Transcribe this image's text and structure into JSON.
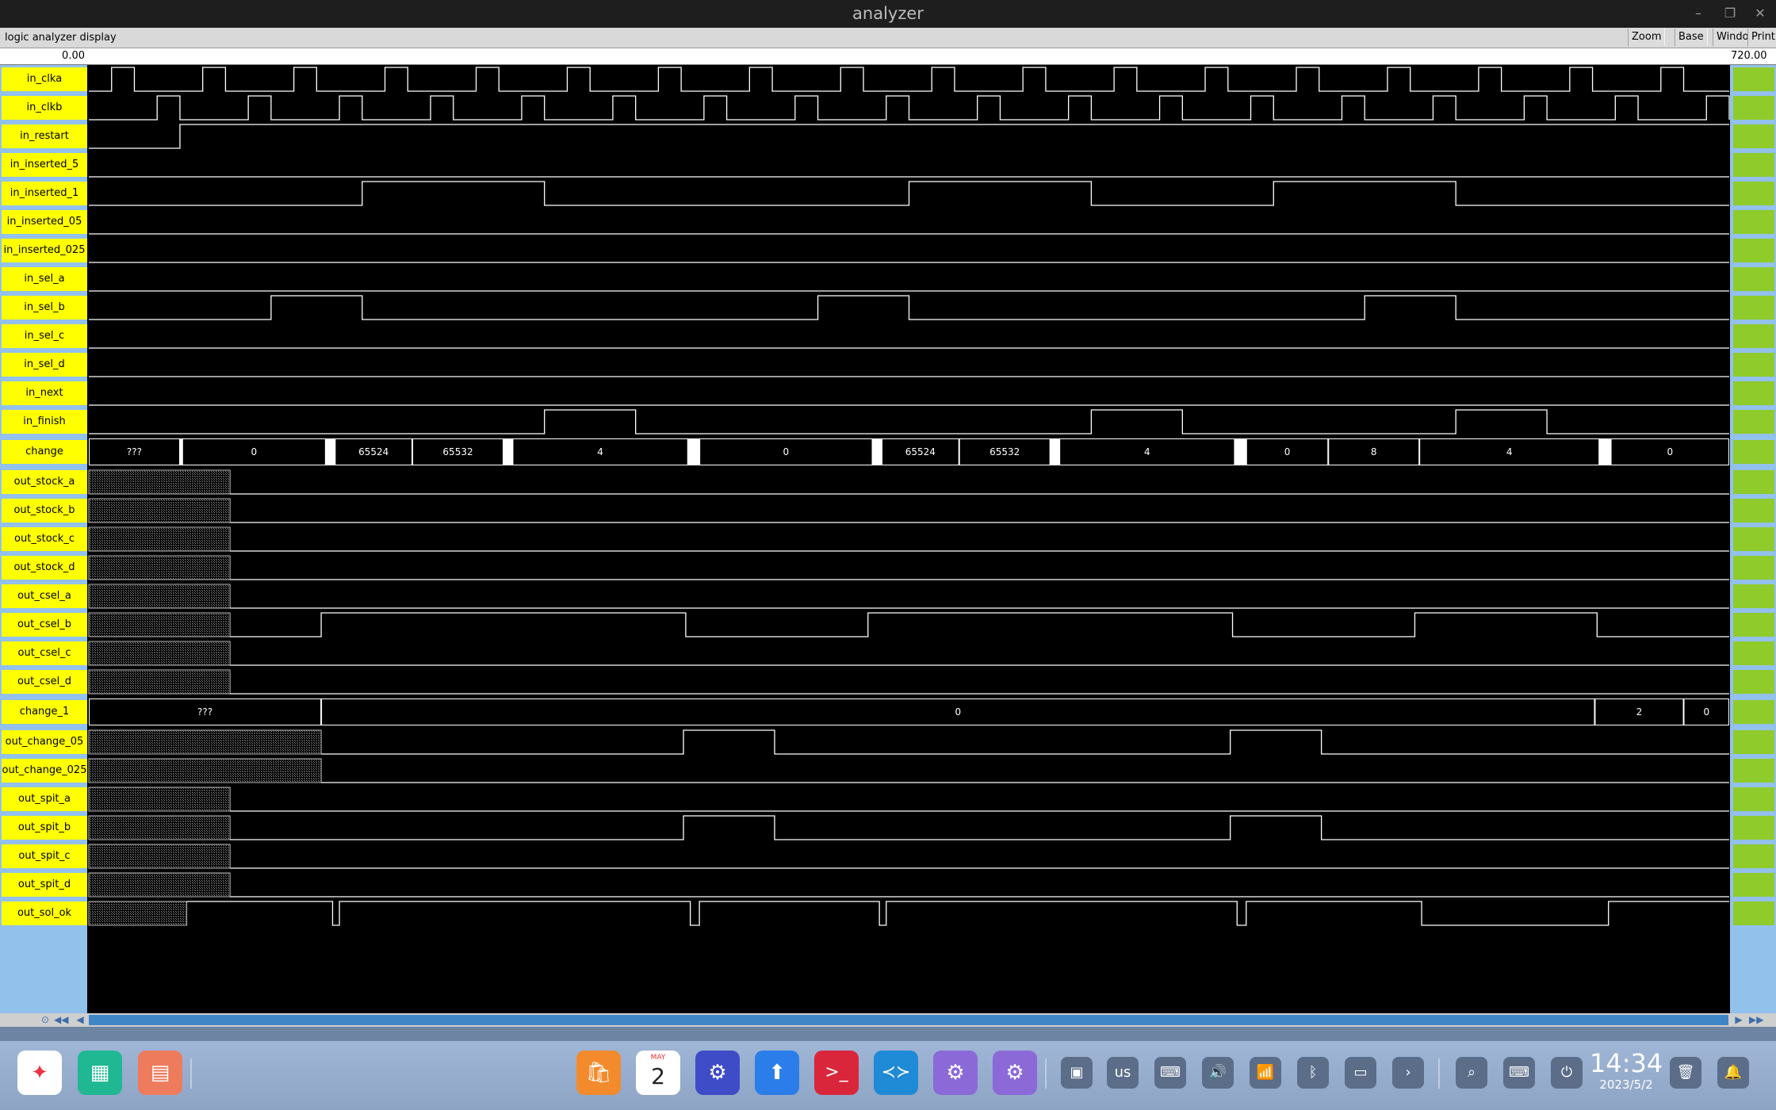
{
  "window": {
    "title": "analyzer",
    "minimize_glyph": "–",
    "restore_glyph": "❐",
    "close_glyph": "✕"
  },
  "toolbar": {
    "label": "logic analyzer display",
    "zoom": "Zoom",
    "base": "Base",
    "window": "Window",
    "print": "Print"
  },
  "ruler": {
    "start": "0.00",
    "end": "720.00"
  },
  "colors": {
    "signal_label_bg": "#ffff00",
    "side_bg": "#92c1ec",
    "green_cell": "#8fcb2a",
    "wave": "#ffffff",
    "hatch": "#808080"
  },
  "timeline": {
    "start": 0,
    "end": 720
  },
  "signals": [
    {
      "name": "in_clka",
      "kind": "clock",
      "period": 40,
      "high_start": 10,
      "high_len": 10
    },
    {
      "name": "in_clkb",
      "kind": "clock",
      "period": 40,
      "high_start": 30,
      "high_len": 10
    },
    {
      "name": "in_restart",
      "kind": "bit",
      "initial": 0,
      "edges": [
        40
      ]
    },
    {
      "name": "in_inserted_5",
      "kind": "bit",
      "initial": 0,
      "edges": []
    },
    {
      "name": "in_inserted_1",
      "kind": "bit",
      "initial": 0,
      "edges": [
        120,
        200,
        360,
        440,
        520,
        600
      ]
    },
    {
      "name": "in_inserted_05",
      "kind": "bit",
      "initial": 0,
      "edges": []
    },
    {
      "name": "in_inserted_025",
      "kind": "bit",
      "initial": 0,
      "edges": []
    },
    {
      "name": "in_sel_a",
      "kind": "bit",
      "initial": 0,
      "edges": []
    },
    {
      "name": "in_sel_b",
      "kind": "bit",
      "initial": 0,
      "edges": [
        80,
        120,
        320,
        360,
        560,
        600
      ]
    },
    {
      "name": "in_sel_c",
      "kind": "bit",
      "initial": 0,
      "edges": []
    },
    {
      "name": "in_sel_d",
      "kind": "bit",
      "initial": 0,
      "edges": []
    },
    {
      "name": "in_next",
      "kind": "bit",
      "initial": 0,
      "edges": []
    },
    {
      "name": "in_finish",
      "kind": "bit",
      "initial": 0,
      "edges": [
        200,
        240,
        440,
        480,
        600,
        640
      ]
    },
    {
      "name": "change",
      "kind": "bus",
      "segments": [
        {
          "s": 0,
          "e": 40,
          "v": "???"
        },
        {
          "s": 41,
          "e": 104,
          "v": "0"
        },
        {
          "s": 108,
          "e": 142,
          "v": "65524"
        },
        {
          "s": 142,
          "e": 182,
          "v": "65532"
        },
        {
          "s": 186,
          "e": 263,
          "v": "4"
        },
        {
          "s": 268,
          "e": 344,
          "v": "0"
        },
        {
          "s": 348,
          "e": 382,
          "v": "65524"
        },
        {
          "s": 382,
          "e": 422,
          "v": "65532"
        },
        {
          "s": 426,
          "e": 503,
          "v": "4"
        },
        {
          "s": 508,
          "e": 544,
          "v": "0"
        },
        {
          "s": 544,
          "e": 584,
          "v": "8"
        },
        {
          "s": 584,
          "e": 663,
          "v": "4"
        },
        {
          "s": 668,
          "e": 720,
          "v": "0"
        }
      ]
    },
    {
      "name": "out_stock_a",
      "kind": "bit",
      "unknown_until": 62,
      "initial": 0,
      "edges": []
    },
    {
      "name": "out_stock_b",
      "kind": "bit",
      "unknown_until": 62,
      "initial": 0,
      "edges": []
    },
    {
      "name": "out_stock_c",
      "kind": "bit",
      "unknown_until": 62,
      "initial": 0,
      "edges": []
    },
    {
      "name": "out_stock_d",
      "kind": "bit",
      "unknown_until": 62,
      "initial": 0,
      "edges": []
    },
    {
      "name": "out_csel_a",
      "kind": "bit",
      "unknown_until": 62,
      "initial": 0,
      "edges": []
    },
    {
      "name": "out_csel_b",
      "kind": "bit",
      "unknown_until": 62,
      "initial": 0,
      "edges": [
        102,
        262,
        342,
        502,
        582,
        662
      ]
    },
    {
      "name": "out_csel_c",
      "kind": "bit",
      "unknown_until": 62,
      "initial": 0,
      "edges": []
    },
    {
      "name": "out_csel_d",
      "kind": "bit",
      "unknown_until": 62,
      "initial": 0,
      "edges": []
    },
    {
      "name": "change_1",
      "kind": "bus",
      "segments": [
        {
          "s": 0,
          "e": 102,
          "v": "???"
        },
        {
          "s": 102,
          "e": 661,
          "v": "0"
        },
        {
          "s": 661,
          "e": 700,
          "v": "2"
        },
        {
          "s": 700,
          "e": 720,
          "v": "0"
        }
      ]
    },
    {
      "name": "out_change_05",
      "kind": "bit",
      "unknown_until": 102,
      "initial": 0,
      "edges": [
        261,
        301,
        501,
        541
      ]
    },
    {
      "name": "out_change_025",
      "kind": "bit",
      "unknown_until": 102,
      "initial": 0,
      "edges": []
    },
    {
      "name": "out_spit_a",
      "kind": "bit",
      "unknown_until": 62,
      "initial": 0,
      "edges": []
    },
    {
      "name": "out_spit_b",
      "kind": "bit",
      "unknown_until": 62,
      "initial": 0,
      "edges": [
        261,
        301,
        501,
        541
      ]
    },
    {
      "name": "out_spit_c",
      "kind": "bit",
      "unknown_until": 62,
      "initial": 0,
      "edges": []
    },
    {
      "name": "out_spit_d",
      "kind": "bit",
      "unknown_until": 62,
      "initial": 0,
      "edges": []
    },
    {
      "name": "out_sol_ok",
      "kind": "bit",
      "unknown_until": 43,
      "initial": 1,
      "edges": [
        107,
        110,
        264,
        268,
        347,
        350,
        504,
        508,
        585,
        667
      ]
    }
  ],
  "scrollbar": {
    "home_glyph": "⊙",
    "rewind_glyph": "◀◀",
    "back_glyph": "◀",
    "fwd_glyph": "▶",
    "ffwd_glyph": "▶▶"
  },
  "dock": {
    "apps": [
      {
        "name": "launcher",
        "glyph": "✦",
        "color": "#ffffff"
      },
      {
        "name": "multitask-view",
        "glyph": "▦",
        "color": "#1fb893"
      },
      {
        "name": "window-manager",
        "glyph": "▤",
        "color": "#ef7b5d"
      },
      {
        "name": "app-store",
        "glyph": "🛍",
        "color": "#f38a2b"
      },
      {
        "name": "calendar",
        "glyph": "2",
        "color": "#ffffff"
      },
      {
        "name": "settings",
        "glyph": "⚙",
        "color": "#3f4cc7"
      },
      {
        "name": "deepin-manager",
        "glyph": "⬆",
        "color": "#2b7de9"
      },
      {
        "name": "terminal",
        "glyph": ">_",
        "color": "#d9263b"
      },
      {
        "name": "vscode",
        "glyph": "≺≻",
        "color": "#1f8ad6"
      },
      {
        "name": "tools-1",
        "glyph": "⚙",
        "color": "#8b6ad8"
      },
      {
        "name": "tools-2",
        "glyph": "⚙",
        "color": "#8b6ad8"
      }
    ],
    "tray": {
      "keyboard_layout": "us",
      "time": "14:34",
      "date": "2023/5/2",
      "calendar_month": "MAY",
      "calendar_day": "2"
    }
  }
}
